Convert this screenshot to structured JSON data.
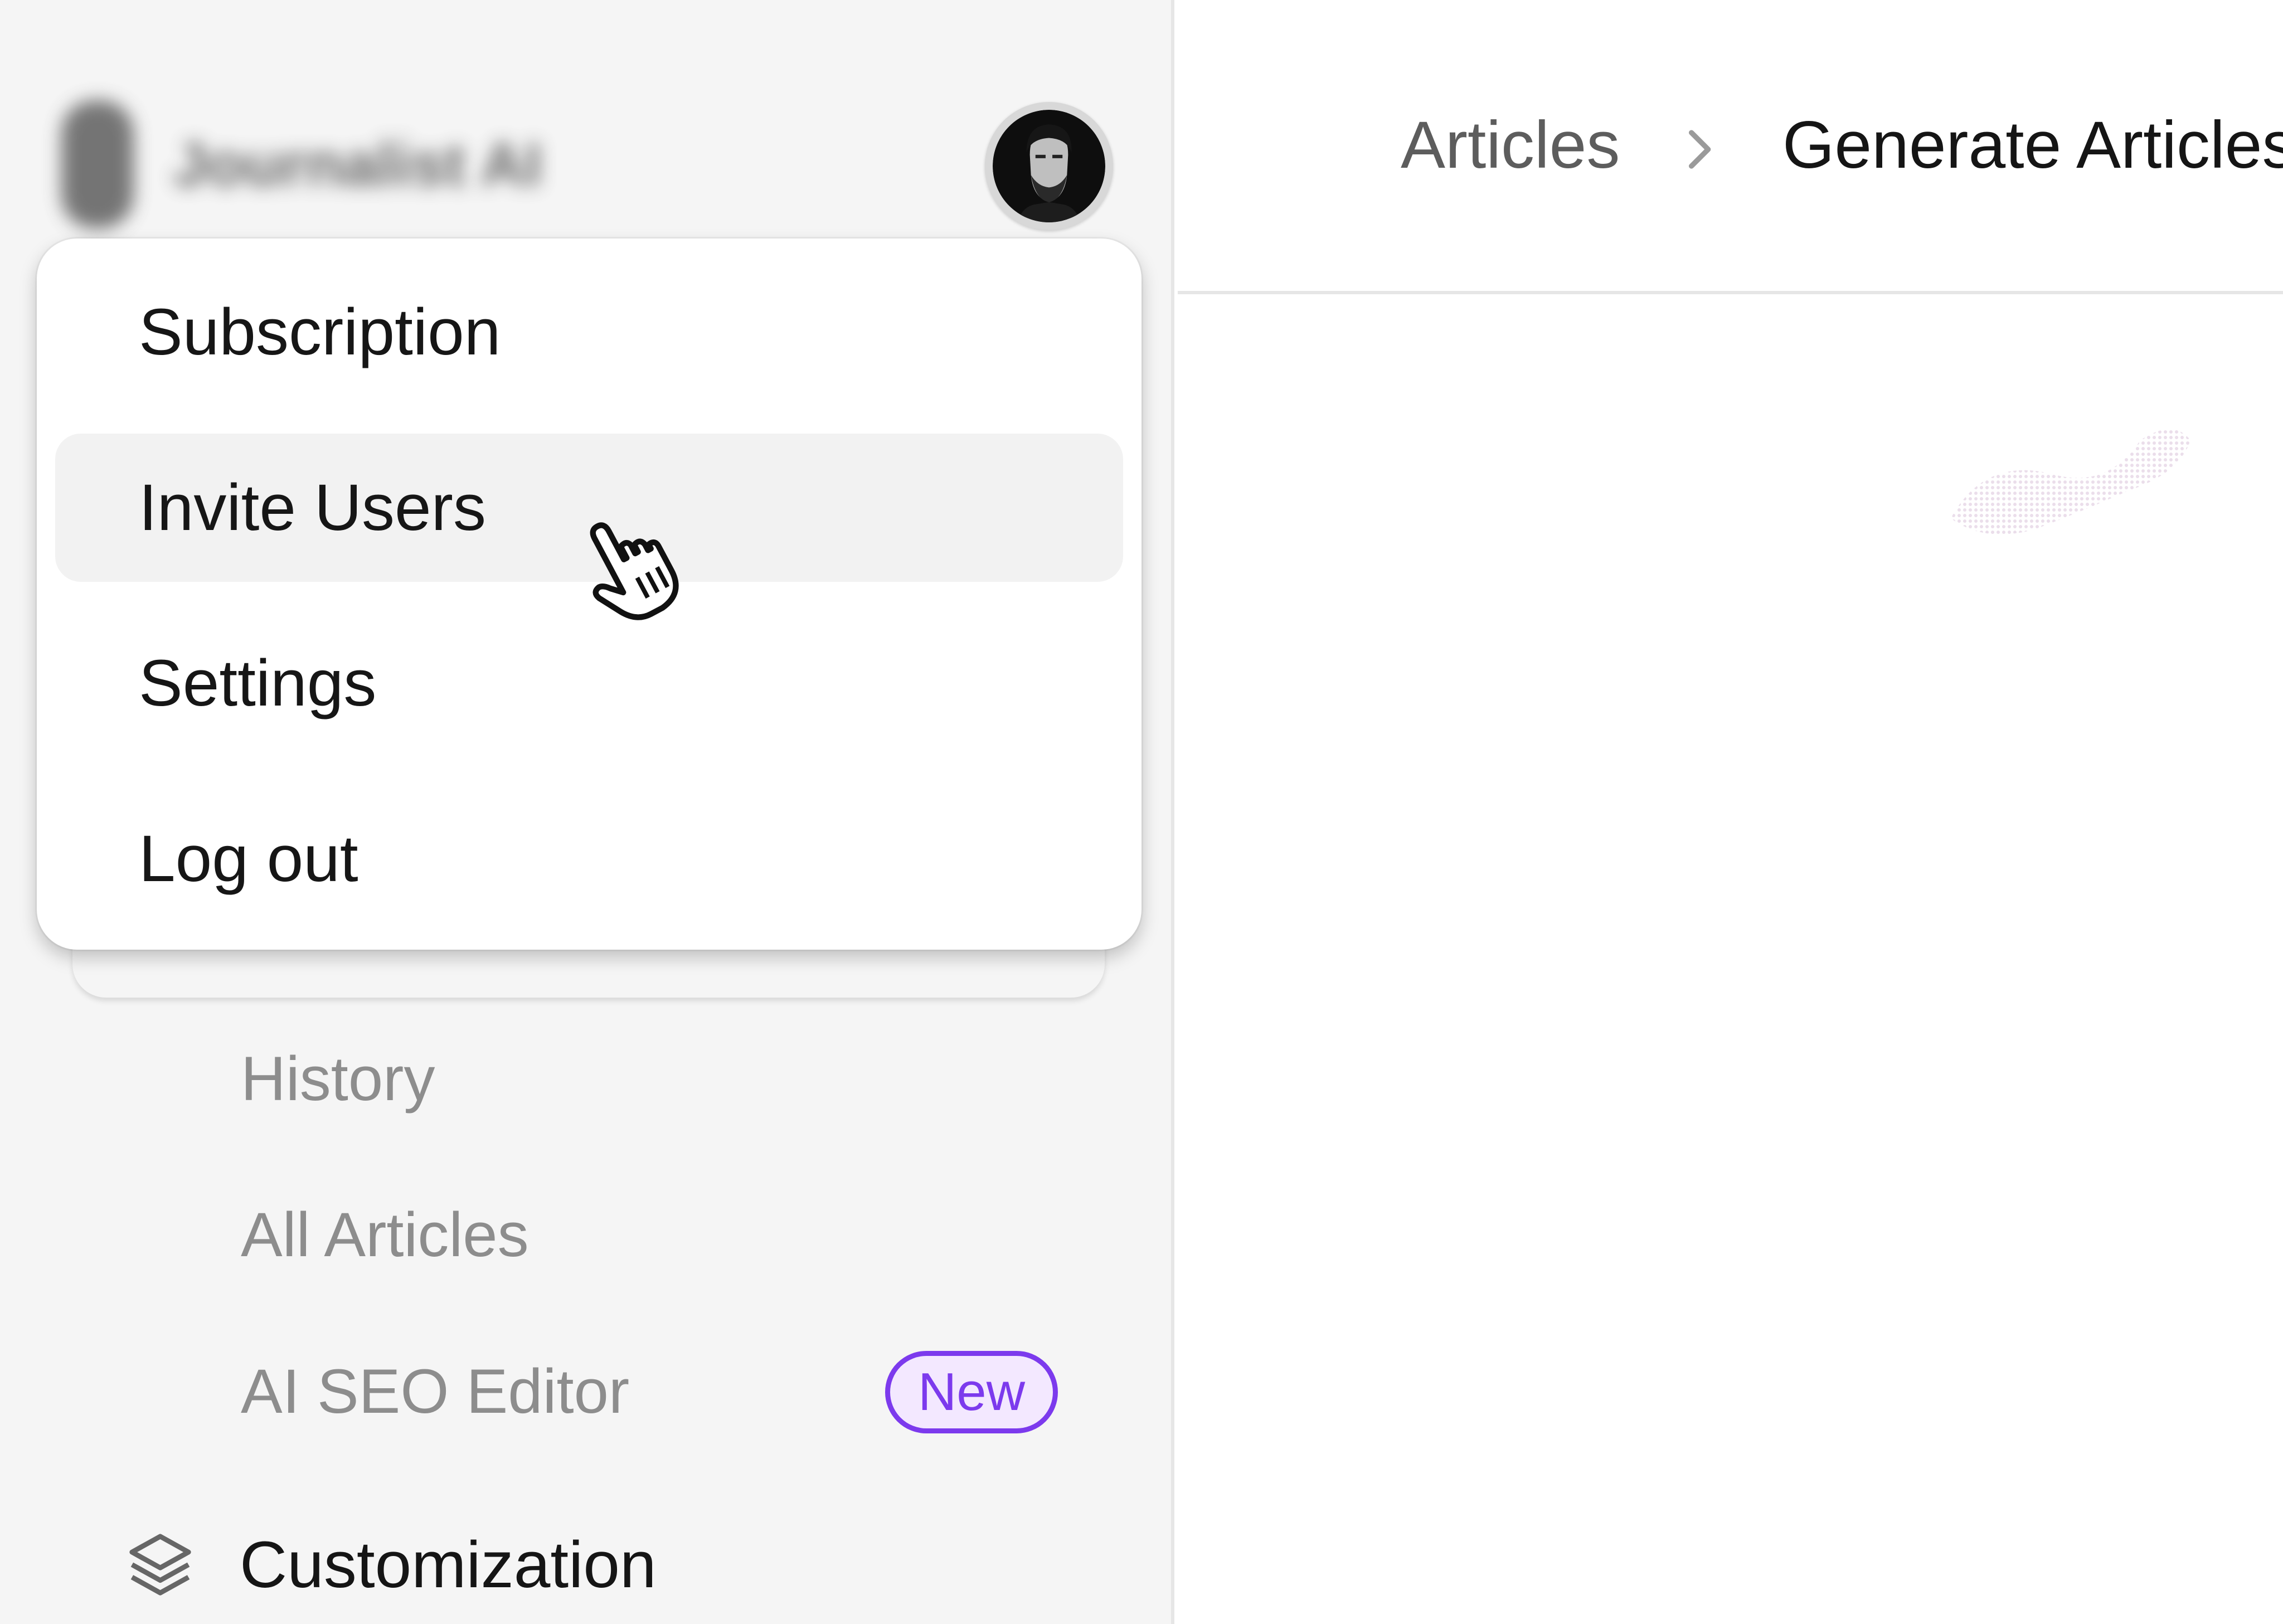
{
  "sidebar": {
    "brand": {
      "name": "Journalist AI"
    },
    "nav": {
      "history": "History",
      "all_articles": "All Articles",
      "ai_seo_editor": "AI SEO Editor",
      "ai_seo_editor_badge": "New",
      "customization": "Customization"
    }
  },
  "user_menu": {
    "avatar_icon": "user-avatar",
    "items": [
      {
        "label": "Subscription"
      },
      {
        "label": "Invite Users",
        "hovered": true
      },
      {
        "label": "Settings"
      },
      {
        "label": "Log out"
      }
    ]
  },
  "header": {
    "breadcrumb": [
      {
        "label": "Articles"
      },
      {
        "label": "Generate Articles"
      }
    ]
  },
  "colors": {
    "accent": "#7c3aed",
    "badge_bg": "#f3e8ff",
    "sidebar_bg": "#f5f5f5",
    "hover_bg": "#f2f2f2"
  }
}
